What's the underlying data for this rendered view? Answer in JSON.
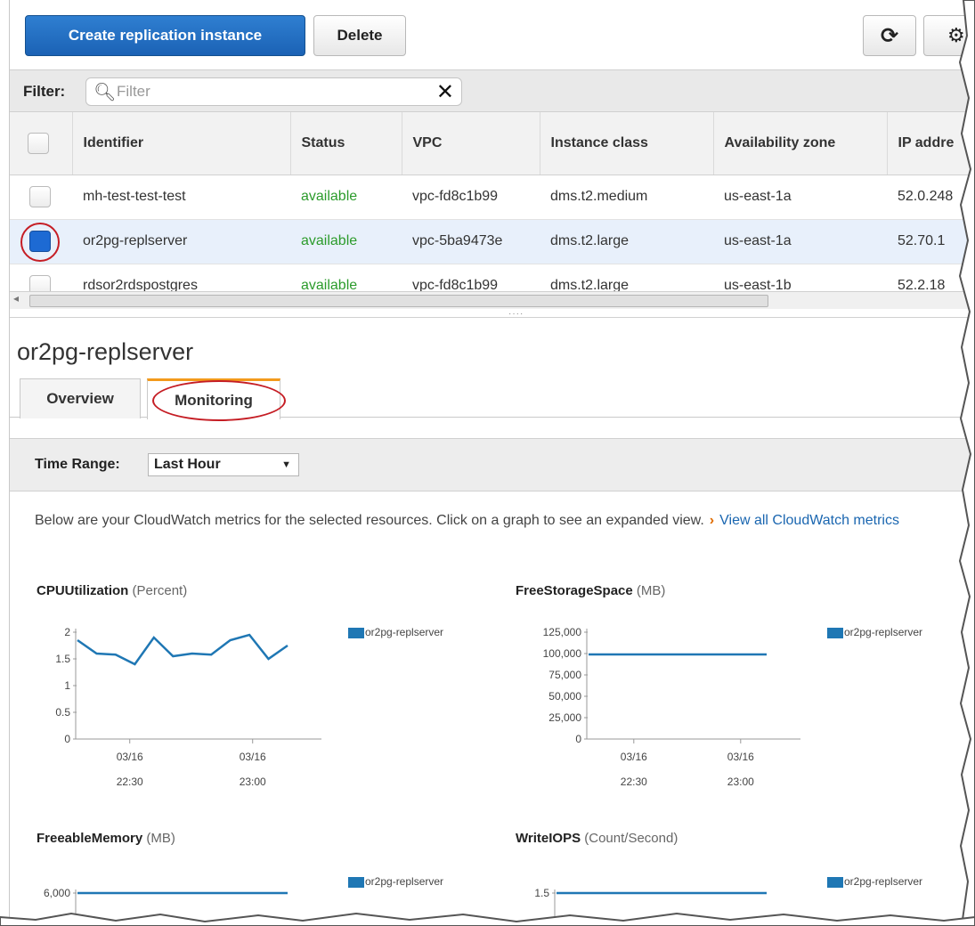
{
  "toolbar": {
    "create_label": "Create replication instance",
    "delete_label": "Delete",
    "refresh_icon": "refresh-icon",
    "settings_icon": "gear-icon"
  },
  "filter": {
    "label": "Filter:",
    "placeholder": "Filter",
    "value": ""
  },
  "table": {
    "columns": [
      "Identifier",
      "Status",
      "VPC",
      "Instance class",
      "Availability zone",
      "IP addre"
    ],
    "rows": [
      {
        "identifier": "mh-test-test-test",
        "status": "available",
        "vpc": "vpc-fd8c1b99",
        "instance_class": "dms.t2.medium",
        "zone": "us-east-1a",
        "ip": "52.0.248",
        "selected": false
      },
      {
        "identifier": "or2pg-replserver",
        "status": "available",
        "vpc": "vpc-5ba9473e",
        "instance_class": "dms.t2.large",
        "zone": "us-east-1a",
        "ip": "52.70.1",
        "selected": true
      },
      {
        "identifier": "rdsor2rdspostgres",
        "status": "available",
        "vpc": "vpc-fd8c1b99",
        "instance_class": "dms.t2.large",
        "zone": "us-east-1b",
        "ip": "52.2.18",
        "selected": false
      }
    ]
  },
  "detail": {
    "title": "or2pg-replserver",
    "tabs": [
      {
        "label": "Overview",
        "active": false
      },
      {
        "label": "Monitoring",
        "active": true
      }
    ],
    "time_range_label": "Time Range:",
    "time_range_value": "Last Hour",
    "info_text": "Below are your CloudWatch metrics for the selected resources. Click on a graph to see an expanded view.",
    "info_link": "View all CloudWatch metrics"
  },
  "colors": {
    "primary_button": "#1b62b5",
    "status_available": "#2b9b2b",
    "series": "#1f77b4",
    "annotation_ring": "#c51d24",
    "active_tab_accent": "#f39a1c"
  },
  "chart_data": [
    {
      "type": "line",
      "title": "CPUUtilization",
      "unit": "(Percent)",
      "legend": "or2pg-replserver",
      "yticks": [
        "2",
        "1.5",
        "1",
        "0.5",
        "0"
      ],
      "ylim": [
        0,
        2
      ],
      "xticks": [
        [
          "03/16",
          "22:30"
        ],
        [
          "03/16",
          "23:00"
        ]
      ],
      "series": [
        {
          "name": "or2pg-replserver",
          "values": [
            1.85,
            1.6,
            1.58,
            1.4,
            1.9,
            1.55,
            1.6,
            1.58,
            1.85,
            1.95,
            1.5,
            1.75
          ]
        }
      ]
    },
    {
      "type": "line",
      "title": "FreeStorageSpace",
      "unit": "(MB)",
      "legend": "or2pg-replserver",
      "yticks": [
        "125,000",
        "100,000",
        "75,000",
        "50,000",
        "25,000",
        "0"
      ],
      "ylim": [
        0,
        125000
      ],
      "xticks": [
        [
          "03/16",
          "22:30"
        ],
        [
          "03/16",
          "23:00"
        ]
      ],
      "series": [
        {
          "name": "or2pg-replserver",
          "values": [
            99000,
            99000,
            99000,
            99000,
            99000,
            99000,
            99000,
            99000,
            99000,
            99000,
            99000,
            99000
          ]
        }
      ]
    },
    {
      "type": "line",
      "title": "FreeableMemory",
      "unit": "(MB)",
      "legend": "or2pg-replserver",
      "yticks": [
        "6,000"
      ],
      "series": [
        {
          "name": "or2pg-replserver",
          "values": [
            5400,
            5350,
            5380,
            5300,
            5420,
            5380,
            5400,
            5350,
            5420,
            5380,
            5400,
            5380
          ]
        }
      ]
    },
    {
      "type": "line",
      "title": "WriteIOPS",
      "unit": "(Count/Second)",
      "legend": "or2pg-replserver",
      "yticks": [
        "1.5"
      ],
      "series": [
        {
          "name": "or2pg-replserver",
          "values": [
            1.2,
            1.25,
            1.3,
            1.4,
            1.35,
            1.3,
            1.25,
            1.4,
            1.3,
            1.35,
            1.3,
            1.3
          ]
        }
      ]
    }
  ]
}
